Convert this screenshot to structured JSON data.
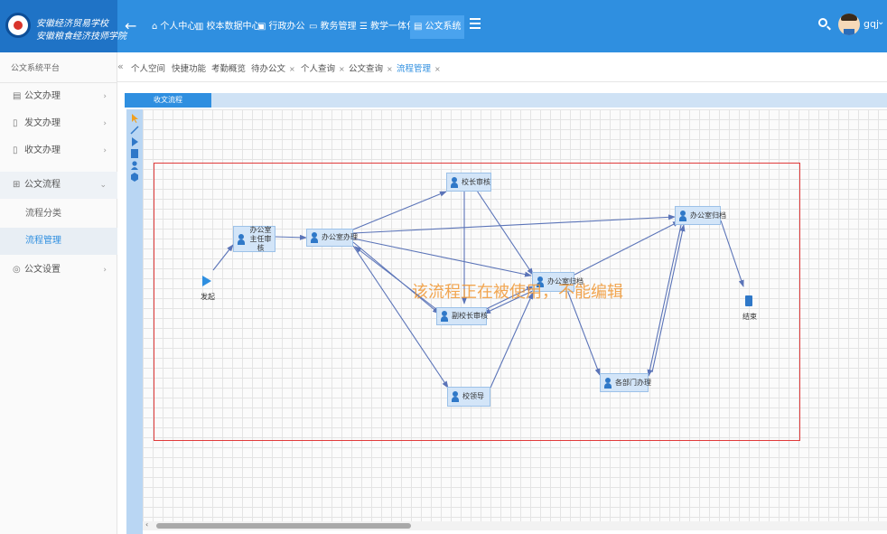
{
  "brand": {
    "logo_line1": "安徽经济贸易学校",
    "logo_line2": "安徽粮食经济技师学院"
  },
  "topnav": {
    "items": [
      {
        "icon": "home-icon",
        "glyph": "⌂",
        "label": "个人中心"
      },
      {
        "icon": "chart-icon",
        "glyph": "▥",
        "label": "校本数据中心"
      },
      {
        "icon": "briefcase-icon",
        "glyph": "▣",
        "label": "行政办公"
      },
      {
        "icon": "monitor-icon",
        "glyph": "▭",
        "label": "教务管理"
      },
      {
        "icon": "list-icon",
        "glyph": "☰",
        "label": "教学一体化"
      },
      {
        "icon": "document-icon",
        "glyph": "▤",
        "label": "公文系统"
      }
    ],
    "active_index": 5,
    "username": "gqj"
  },
  "sidebar": {
    "title": "公文系统平台",
    "items": [
      {
        "icon": "document-icon",
        "label": "公文办理",
        "chevron": "›"
      },
      {
        "icon": "send-doc-icon",
        "label": "发文办理",
        "chevron": "›"
      },
      {
        "icon": "receive-doc-icon",
        "label": "收文办理",
        "chevron": "›"
      },
      {
        "icon": "flow-icon",
        "label": "公文流程",
        "chevron": "⌄"
      }
    ],
    "subitems": [
      {
        "label": "流程分类"
      },
      {
        "label": "流程管理"
      }
    ],
    "settings": {
      "icon": "settings-icon",
      "label": "公文设置",
      "chevron": "›"
    }
  },
  "tabs": {
    "prev": "«",
    "items": [
      {
        "label": "个人空间",
        "closable": false
      },
      {
        "label": "快捷功能",
        "closable": false
      },
      {
        "label": "考勤概览",
        "closable": false
      },
      {
        "label": "待办公文",
        "closable": true
      },
      {
        "label": "个人查询",
        "closable": true
      },
      {
        "label": "公文查询",
        "closable": true
      },
      {
        "label": "流程管理",
        "closable": true
      }
    ],
    "close_glyph": "×"
  },
  "panel": {
    "tab_label": "收文流程"
  },
  "flow": {
    "start_label": "发起",
    "end_label": "结束",
    "nodes": {
      "office_director": "办公室主任审核",
      "office_handle": "办公室办理",
      "principal": "校长审核",
      "vice_principal": "副校长审核",
      "school_leader": "校领导",
      "office_file": "办公室归档",
      "office_file_2": "办公室归档",
      "dept_handle": "各部门办理"
    },
    "watermark": "该流程正在被使用，不能编辑"
  },
  "colors": {
    "topbar": "#2f8fe0",
    "accent": "#2f8fe0",
    "frame": "#e03a3a",
    "edge": "#5b74b8",
    "watermark": "#f0962f"
  }
}
